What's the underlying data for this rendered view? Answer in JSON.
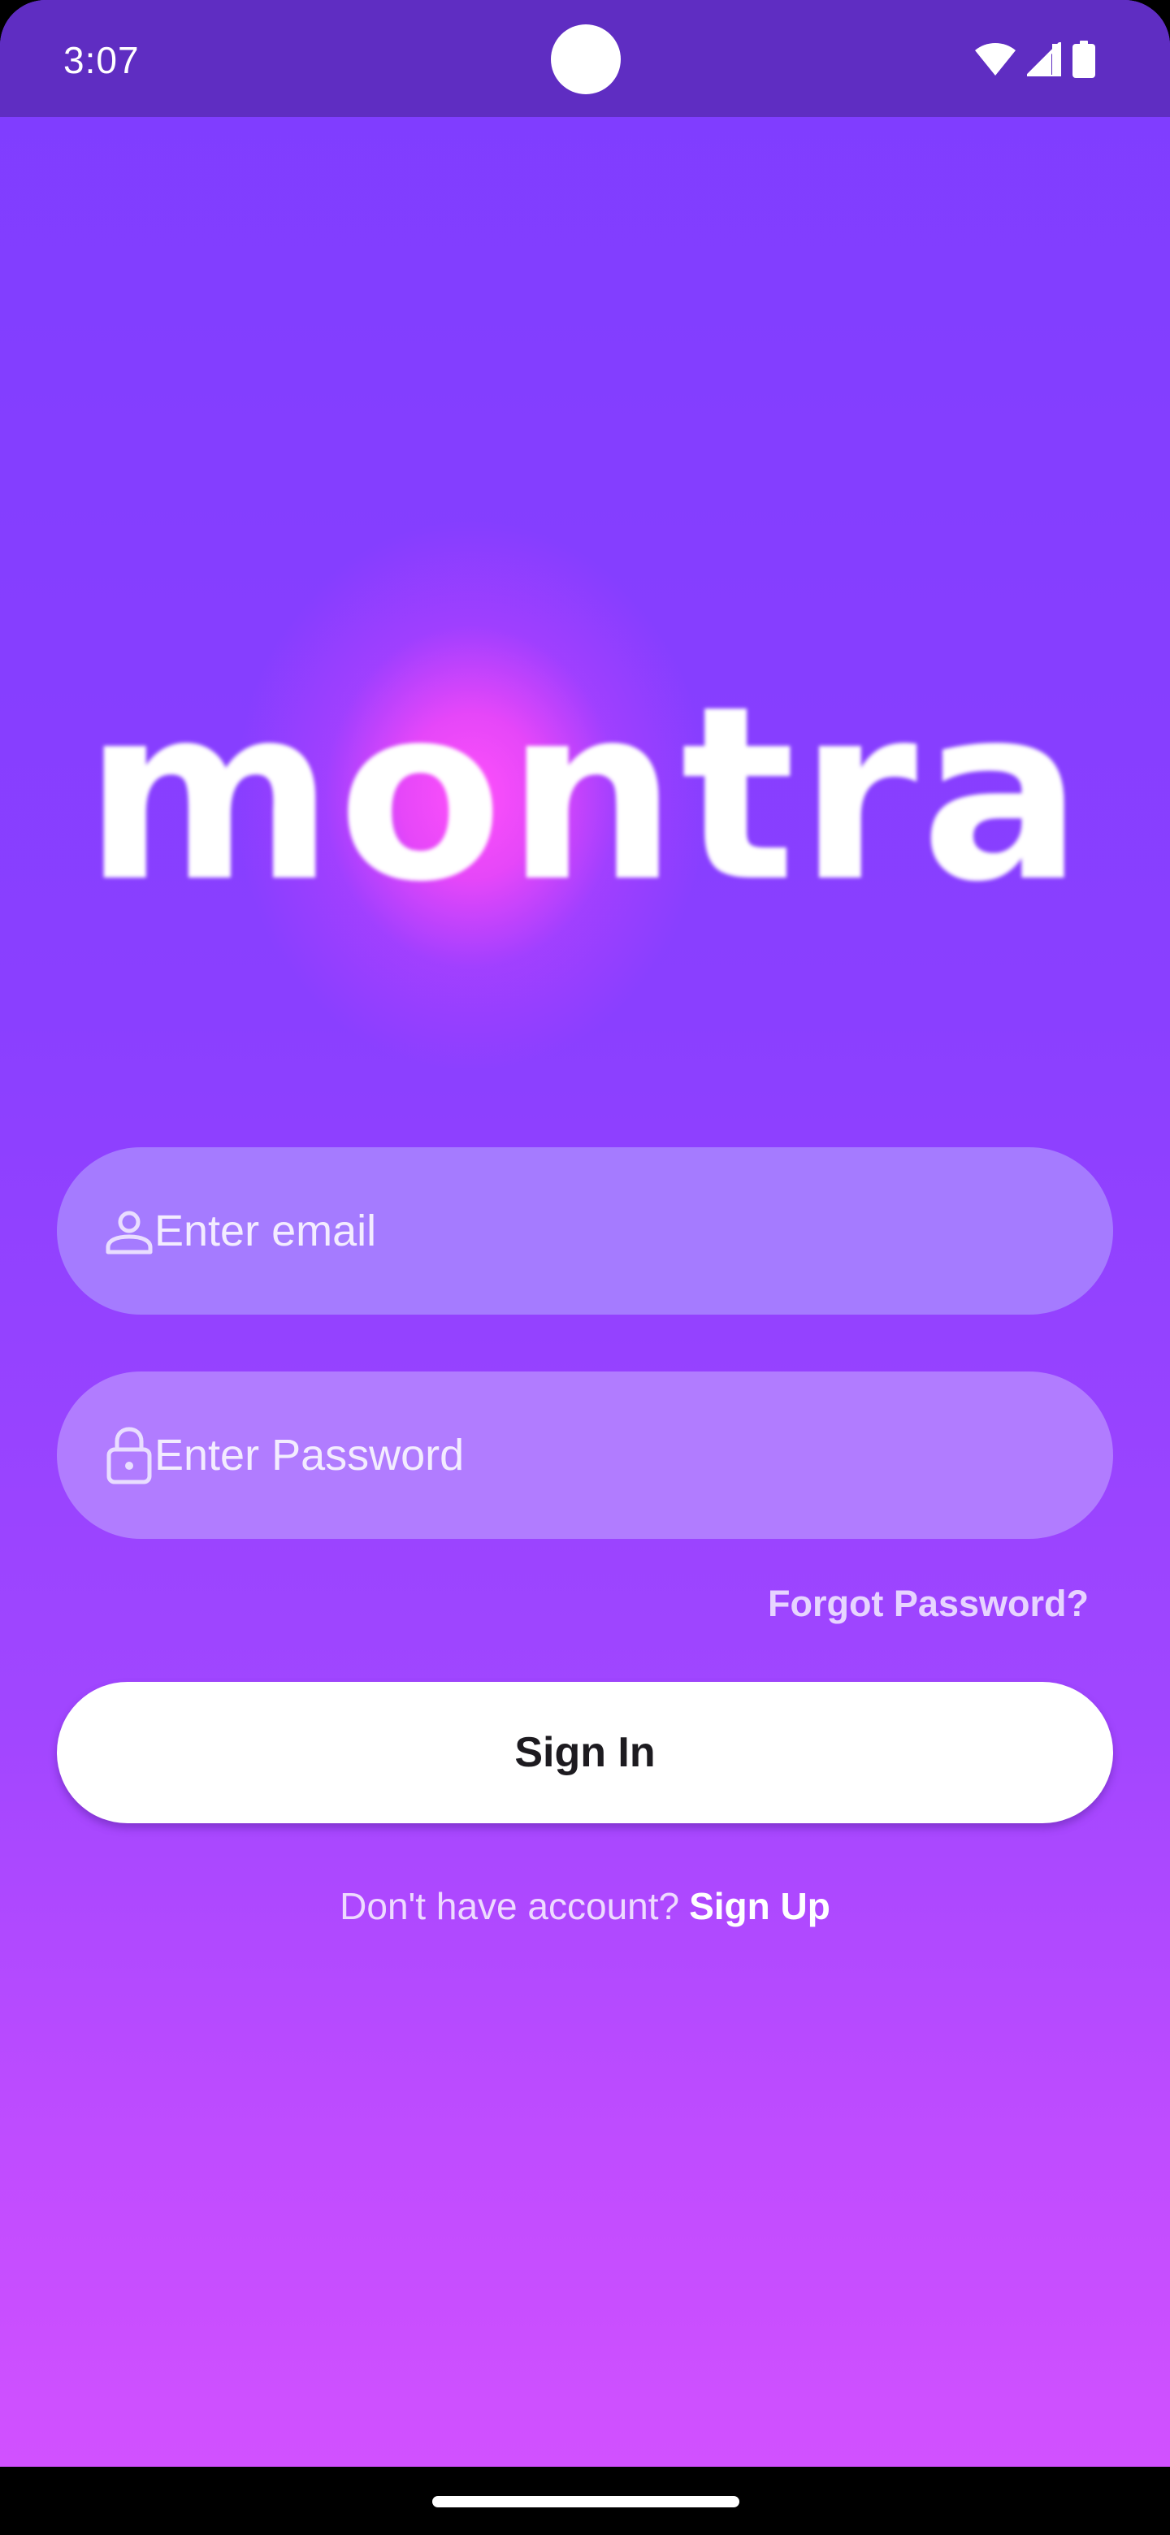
{
  "status_bar": {
    "time": "3:07",
    "icons": [
      "wifi-icon",
      "cell-signal-icon",
      "battery-icon"
    ]
  },
  "logo": {
    "text": "montra"
  },
  "form": {
    "email": {
      "placeholder": "Enter email",
      "value": "",
      "icon": "user-icon"
    },
    "password": {
      "placeholder": "Enter Password",
      "value": "",
      "icon": "lock-icon"
    },
    "forgot_label": "Forgot Password?",
    "signin_label": "Sign In",
    "signup_prompt": "Don't have account?",
    "signup_label": "Sign Up"
  },
  "colors": {
    "status_bar": "#5f2dc2",
    "gradient_top": "#7f3dff",
    "gradient_bottom": "#d552ff",
    "glow": "#ff50fa",
    "button_bg": "#ffffff",
    "button_text": "#1d1b20"
  }
}
